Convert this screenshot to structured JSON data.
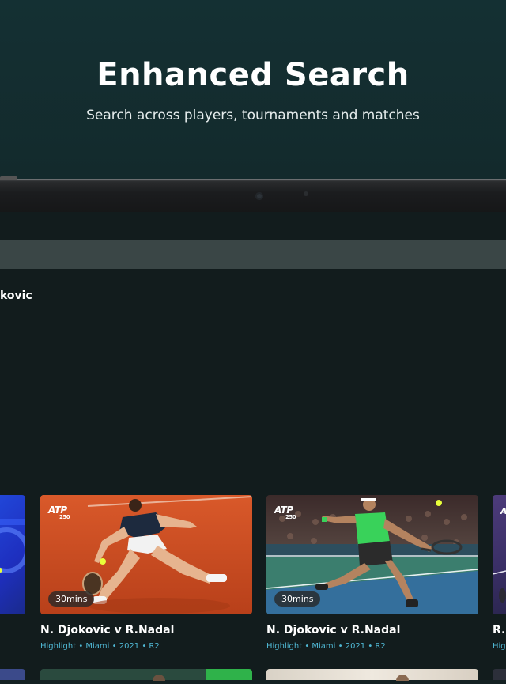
{
  "hero": {
    "title": "Enhanced Search",
    "subtitle": "Search across players, tournaments and matches"
  },
  "search": {
    "query": "kovic"
  },
  "results": [
    {
      "title": "N. Djokovic v R.Nadal",
      "meta": "Highlight • Miami • 2021 • R2",
      "duration": "30mins",
      "logo": "ATP",
      "logo_sub": "250"
    },
    {
      "title": "N. Djokovic v R.Nadal",
      "meta": "Highlight • Miami • 2021 • R2",
      "duration": "30mins",
      "logo": "ATP",
      "logo_sub": "250"
    }
  ],
  "peek_right": {
    "title": "R.I",
    "meta": "Hig"
  },
  "colors": {
    "hero_bg": "#143033",
    "screen_bg": "#121c1d",
    "meta_accent": "#4fb7d3",
    "clay": "#cf4a1e",
    "hard_court": "#3b7e6e"
  }
}
